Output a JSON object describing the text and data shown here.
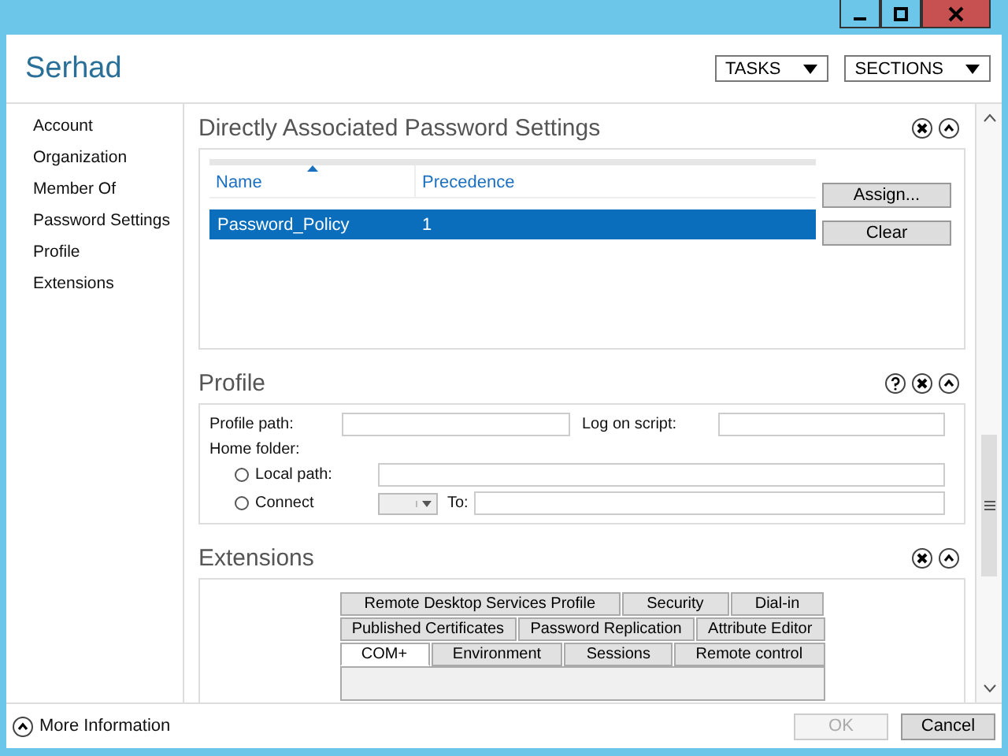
{
  "window": {
    "title": "Serhad"
  },
  "header_buttons": [
    {
      "label": "TASKS"
    },
    {
      "label": "SECTIONS"
    }
  ],
  "sidebar": {
    "items": [
      {
        "label": "Account"
      },
      {
        "label": "Organization"
      },
      {
        "label": "Member Of"
      },
      {
        "label": "Password Settings"
      },
      {
        "label": "Profile"
      },
      {
        "label": "Extensions"
      }
    ]
  },
  "password_settings": {
    "title": "Directly Associated Password Settings",
    "table": {
      "columns": [
        {
          "label": "Name",
          "sorted": true
        },
        {
          "label": "Precedence",
          "sorted": false
        }
      ],
      "rows": [
        {
          "cells": [
            "Password_Policy",
            "1"
          ],
          "selected": true
        }
      ]
    },
    "buttons": [
      {
        "label": "Assign..."
      },
      {
        "label": "Clear"
      }
    ]
  },
  "profile": {
    "title": "Profile",
    "profile_path_label": "Profile path:",
    "log_on_script_label": "Log on script:",
    "home_folder_label": "Home folder:",
    "options": [
      {
        "label": "Local path:",
        "kind": "path",
        "selected": false
      },
      {
        "label": "Connect",
        "kind": "connect",
        "selected": false
      }
    ],
    "to_label": "To:"
  },
  "extensions": {
    "title": "Extensions",
    "tab_rows": [
      [
        {
          "label": "Remote Desktop Services Profile",
          "selected": false
        },
        {
          "label": "Security",
          "selected": false
        },
        {
          "label": "Dial-in",
          "selected": false
        }
      ],
      [
        {
          "label": "Published Certificates",
          "selected": false
        },
        {
          "label": "Password Replication",
          "selected": false
        },
        {
          "label": "Attribute Editor",
          "selected": false
        }
      ],
      [
        {
          "label": "COM+",
          "selected": true
        },
        {
          "label": "Environment",
          "selected": false
        },
        {
          "label": "Sessions",
          "selected": false
        },
        {
          "label": "Remote control",
          "selected": false
        }
      ]
    ]
  },
  "footer": {
    "more_info": "More Information",
    "buttons": [
      {
        "label": "OK",
        "disabled": true
      },
      {
        "label": "Cancel",
        "disabled": false
      }
    ]
  }
}
